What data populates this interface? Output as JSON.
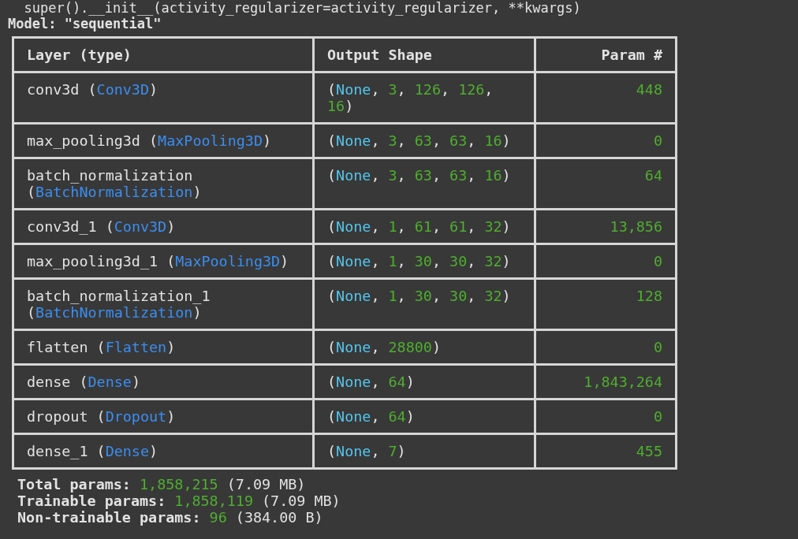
{
  "console_line": "  super().__init__(activity_regularizer=activity_regularizer, **kwargs)",
  "model_title": "Model: \"sequential\"",
  "table": {
    "columns": [
      {
        "label": "Layer (type)",
        "numeric": false
      },
      {
        "label": "Output Shape",
        "numeric": false
      },
      {
        "label": "Param #",
        "numeric": true
      }
    ],
    "rows": [
      {
        "layer": [
          {
            "kind": "plain",
            "text": "conv3d ("
          },
          {
            "kind": "type",
            "text": "Conv3D"
          },
          {
            "kind": "plain",
            "text": ")"
          }
        ],
        "shape": [
          {
            "kind": "plain",
            "text": "("
          },
          {
            "kind": "none",
            "text": "None"
          },
          {
            "kind": "plain",
            "text": ", "
          },
          {
            "kind": "number",
            "text": "3"
          },
          {
            "kind": "plain",
            "text": ", "
          },
          {
            "kind": "number",
            "text": "126"
          },
          {
            "kind": "plain",
            "text": ", "
          },
          {
            "kind": "number",
            "text": "126"
          },
          {
            "kind": "plain",
            "text": ", "
          },
          {
            "kind": "number",
            "text": "16"
          },
          {
            "kind": "plain",
            "text": ")"
          }
        ],
        "params": "448"
      },
      {
        "layer": [
          {
            "kind": "plain",
            "text": "max_pooling3d ("
          },
          {
            "kind": "type",
            "text": "MaxPooling3D"
          },
          {
            "kind": "plain",
            "text": ")"
          }
        ],
        "shape": [
          {
            "kind": "plain",
            "text": "("
          },
          {
            "kind": "none",
            "text": "None"
          },
          {
            "kind": "plain",
            "text": ", "
          },
          {
            "kind": "number",
            "text": "3"
          },
          {
            "kind": "plain",
            "text": ", "
          },
          {
            "kind": "number",
            "text": "63"
          },
          {
            "kind": "plain",
            "text": ", "
          },
          {
            "kind": "number",
            "text": "63"
          },
          {
            "kind": "plain",
            "text": ", "
          },
          {
            "kind": "number",
            "text": "16"
          },
          {
            "kind": "plain",
            "text": ")"
          }
        ],
        "params": "0"
      },
      {
        "layer": [
          {
            "kind": "plain",
            "text": "batch_normalization ("
          },
          {
            "kind": "type",
            "text": "BatchNormalization"
          },
          {
            "kind": "plain",
            "text": ")"
          }
        ],
        "shape": [
          {
            "kind": "plain",
            "text": "("
          },
          {
            "kind": "none",
            "text": "None"
          },
          {
            "kind": "plain",
            "text": ", "
          },
          {
            "kind": "number",
            "text": "3"
          },
          {
            "kind": "plain",
            "text": ", "
          },
          {
            "kind": "number",
            "text": "63"
          },
          {
            "kind": "plain",
            "text": ", "
          },
          {
            "kind": "number",
            "text": "63"
          },
          {
            "kind": "plain",
            "text": ", "
          },
          {
            "kind": "number",
            "text": "16"
          },
          {
            "kind": "plain",
            "text": ")"
          }
        ],
        "params": "64"
      },
      {
        "layer": [
          {
            "kind": "plain",
            "text": "conv3d_1 ("
          },
          {
            "kind": "type",
            "text": "Conv3D"
          },
          {
            "kind": "plain",
            "text": ")"
          }
        ],
        "shape": [
          {
            "kind": "plain",
            "text": "("
          },
          {
            "kind": "none",
            "text": "None"
          },
          {
            "kind": "plain",
            "text": ", "
          },
          {
            "kind": "number",
            "text": "1"
          },
          {
            "kind": "plain",
            "text": ", "
          },
          {
            "kind": "number",
            "text": "61"
          },
          {
            "kind": "plain",
            "text": ", "
          },
          {
            "kind": "number",
            "text": "61"
          },
          {
            "kind": "plain",
            "text": ", "
          },
          {
            "kind": "number",
            "text": "32"
          },
          {
            "kind": "plain",
            "text": ")"
          }
        ],
        "params": "13,856"
      },
      {
        "layer": [
          {
            "kind": "plain",
            "text": "max_pooling3d_1 ("
          },
          {
            "kind": "type",
            "text": "MaxPooling3D"
          },
          {
            "kind": "plain",
            "text": ")"
          }
        ],
        "shape": [
          {
            "kind": "plain",
            "text": "("
          },
          {
            "kind": "none",
            "text": "None"
          },
          {
            "kind": "plain",
            "text": ", "
          },
          {
            "kind": "number",
            "text": "1"
          },
          {
            "kind": "plain",
            "text": ", "
          },
          {
            "kind": "number",
            "text": "30"
          },
          {
            "kind": "plain",
            "text": ", "
          },
          {
            "kind": "number",
            "text": "30"
          },
          {
            "kind": "plain",
            "text": ", "
          },
          {
            "kind": "number",
            "text": "32"
          },
          {
            "kind": "plain",
            "text": ")"
          }
        ],
        "params": "0"
      },
      {
        "layer": [
          {
            "kind": "plain",
            "text": "batch_normalization_1 ("
          },
          {
            "kind": "type",
            "text": "BatchNormalization"
          },
          {
            "kind": "plain",
            "text": ")"
          }
        ],
        "shape": [
          {
            "kind": "plain",
            "text": "("
          },
          {
            "kind": "none",
            "text": "None"
          },
          {
            "kind": "plain",
            "text": ", "
          },
          {
            "kind": "number",
            "text": "1"
          },
          {
            "kind": "plain",
            "text": ", "
          },
          {
            "kind": "number",
            "text": "30"
          },
          {
            "kind": "plain",
            "text": ", "
          },
          {
            "kind": "number",
            "text": "30"
          },
          {
            "kind": "plain",
            "text": ", "
          },
          {
            "kind": "number",
            "text": "32"
          },
          {
            "kind": "plain",
            "text": ")"
          }
        ],
        "params": "128"
      },
      {
        "layer": [
          {
            "kind": "plain",
            "text": "flatten ("
          },
          {
            "kind": "type",
            "text": "Flatten"
          },
          {
            "kind": "plain",
            "text": ")"
          }
        ],
        "shape": [
          {
            "kind": "plain",
            "text": "("
          },
          {
            "kind": "none",
            "text": "None"
          },
          {
            "kind": "plain",
            "text": ", "
          },
          {
            "kind": "number",
            "text": "28800"
          },
          {
            "kind": "plain",
            "text": ")"
          }
        ],
        "params": "0"
      },
      {
        "layer": [
          {
            "kind": "plain",
            "text": "dense ("
          },
          {
            "kind": "type",
            "text": "Dense"
          },
          {
            "kind": "plain",
            "text": ")"
          }
        ],
        "shape": [
          {
            "kind": "plain",
            "text": "("
          },
          {
            "kind": "none",
            "text": "None"
          },
          {
            "kind": "plain",
            "text": ", "
          },
          {
            "kind": "number",
            "text": "64"
          },
          {
            "kind": "plain",
            "text": ")"
          }
        ],
        "params": "1,843,264"
      },
      {
        "layer": [
          {
            "kind": "plain",
            "text": "dropout ("
          },
          {
            "kind": "type",
            "text": "Dropout"
          },
          {
            "kind": "plain",
            "text": ")"
          }
        ],
        "shape": [
          {
            "kind": "plain",
            "text": "("
          },
          {
            "kind": "none",
            "text": "None"
          },
          {
            "kind": "plain",
            "text": ", "
          },
          {
            "kind": "number",
            "text": "64"
          },
          {
            "kind": "plain",
            "text": ")"
          }
        ],
        "params": "0"
      },
      {
        "layer": [
          {
            "kind": "plain",
            "text": "dense_1 ("
          },
          {
            "kind": "type",
            "text": "Dense"
          },
          {
            "kind": "plain",
            "text": ")"
          }
        ],
        "shape": [
          {
            "kind": "plain",
            "text": "("
          },
          {
            "kind": "none",
            "text": "None"
          },
          {
            "kind": "plain",
            "text": ", "
          },
          {
            "kind": "number",
            "text": "7"
          },
          {
            "kind": "plain",
            "text": ")"
          }
        ],
        "params": "455"
      }
    ]
  },
  "summary": [
    [
      {
        "kind": "plain",
        "text": "Total params: "
      },
      {
        "kind": "number",
        "text": "1,858,215"
      },
      {
        "kind": "note",
        "text": " (7.09 MB)"
      }
    ],
    [
      {
        "kind": "plain",
        "text": "Trainable params: "
      },
      {
        "kind": "number",
        "text": "1,858,119"
      },
      {
        "kind": "note",
        "text": " (7.09 MB)"
      }
    ],
    [
      {
        "kind": "plain",
        "text": "Non-trainable params: "
      },
      {
        "kind": "number",
        "text": "96"
      },
      {
        "kind": "note",
        "text": " (384.00 B)"
      }
    ]
  ]
}
